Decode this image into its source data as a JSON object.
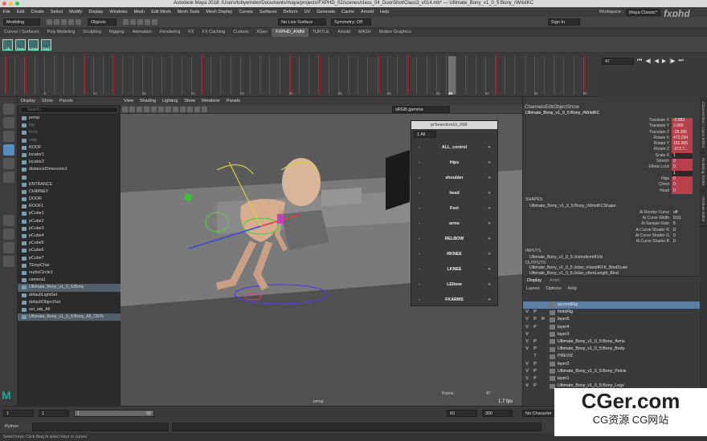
{
  "window": {
    "title": "Autodesk Maya 2018: /Users/tobywinder/Documents/maya/projects/FXPHD_02/scenes/class_04_DoorShot/Class3_v014.mb*  ---  Ultimate_Bony_v1_0_5:Bony_rWristKC"
  },
  "menubar": {
    "items": [
      "File",
      "Edit",
      "Create",
      "Select",
      "Modify",
      "Display",
      "Windows",
      "Mesh",
      "Edit Mesh",
      "Mesh Tools",
      "Mesh Display",
      "Curves",
      "Surfaces",
      "Deform",
      "UV",
      "Generate",
      "Cache",
      "Arnold",
      "Help"
    ],
    "workspace_label": "Workspace :",
    "workspace_value": "Maya Classic*"
  },
  "statusline": {
    "mode": "Modeling",
    "objects": "Objects",
    "live_surface": "No Live Surface",
    "symmetry": "Symmetry: Off",
    "sign_in": "Sign In"
  },
  "shelf": {
    "tabs": [
      "Curves / Surfaces",
      "Poly Modeling",
      "Sculpting",
      "Rigging",
      "Animation",
      "Rendering",
      "FX",
      "FX Caching",
      "Custom",
      "XGen",
      "FXPHD_ANIM",
      "TURTLE",
      "Arnold",
      "MASH",
      "Motion Graphics"
    ],
    "active_tab": "FXPHD_ANIM",
    "buttons": [
      "LIB",
      "Persp",
      "Combo",
      "SNAP"
    ]
  },
  "timeslider": {
    "current_frame": "46",
    "frame_field": "47",
    "labels": [
      "5",
      "10",
      "15",
      "20",
      "25",
      "30",
      "35",
      "40",
      "45",
      "50",
      "55",
      "60"
    ]
  },
  "outliner": {
    "menu": [
      "Display",
      "Show",
      "Panels"
    ],
    "search_placeholder": "Search...",
    "items": [
      {
        "label": "persp",
        "dim": false
      },
      {
        "label": "top",
        "dim": true
      },
      {
        "label": "front",
        "dim": true
      },
      {
        "label": "side",
        "dim": true
      },
      {
        "label": "ROOF",
        "dim": false
      },
      {
        "label": "locator1",
        "dim": false
      },
      {
        "label": "locator2",
        "dim": false
      },
      {
        "label": "distanceDimension1",
        "dim": false
      },
      {
        "label": "",
        "dim": false
      },
      {
        "label": "ENTRANCE",
        "dim": false
      },
      {
        "label": "CHIMNEY",
        "dim": false
      },
      {
        "label": "DOOR",
        "dim": false
      },
      {
        "label": "ROOF1",
        "dim": false
      },
      {
        "label": "pCube1",
        "dim": false
      },
      {
        "label": "pCube2",
        "dim": false
      },
      {
        "label": "pCube3",
        "dim": false
      },
      {
        "label": "pCube4",
        "dim": false
      },
      {
        "label": "pCube5",
        "dim": false
      },
      {
        "label": "pCube6",
        "dim": false
      },
      {
        "label": "pCube7",
        "dim": false
      },
      {
        "label": "TEmpChar",
        "dim": false
      },
      {
        "label": "nurbsCircle1",
        "dim": false
      },
      {
        "label": "camera1",
        "dim": false
      },
      {
        "label": "Ultimate_Bony_v1_0_5:Bony",
        "dim": false,
        "sel": true
      },
      {
        "label": "defaultLightSet",
        "dim": false
      },
      {
        "label": "defaultObjectSet",
        "dim": false
      },
      {
        "label": "set_tab_All",
        "dim": false
      },
      {
        "label": "Ultimate_Bony_v1_0_5:Bony_All_CNTs",
        "dim": false,
        "sel": true
      }
    ]
  },
  "viewport": {
    "menu": [
      "View",
      "Shading",
      "Lighting",
      "Show",
      "Renderer",
      "Panels"
    ],
    "colorspace": "sRGB gamma",
    "camera_label": "persp",
    "frame_label": "Frame:",
    "frame_value": "47",
    "fps": "1.7 fps"
  },
  "selection_ui": {
    "title": "prSelectionUI_098",
    "filter": "1 All",
    "rows": [
      "ALL_control",
      "Hips",
      "shoulder",
      "head",
      "Feet",
      "arms",
      "RELBOW",
      "RKNEE",
      "LKNEE",
      "LElbow",
      "FKARMS"
    ]
  },
  "channel_box": {
    "menu": [
      "Channels",
      "Edit",
      "Object",
      "Show"
    ],
    "object_name": "Ultimate_Bony_v1_0_5:Bony_rWristKC",
    "attributes": [
      {
        "name": "Translate X",
        "value": "-0.883",
        "keyed": true
      },
      {
        "name": "Translate Y",
        "value": "3.989",
        "keyed": true
      },
      {
        "name": "Translate Z",
        "value": "-28.286",
        "keyed": true
      },
      {
        "name": "Rotate X",
        "value": "473.234",
        "keyed": true
      },
      {
        "name": "Rotate Y",
        "value": "182.955",
        "keyed": true
      },
      {
        "name": "Rotate Z",
        "value": "-572.7...",
        "keyed": true
      },
      {
        "name": "Scale X",
        "value": "1",
        "keyed": false
      },
      {
        "name": "Stretch",
        "value": "0",
        "keyed": true
      },
      {
        "name": "Elbow Lock",
        "value": "0",
        "keyed": true
      },
      {
        "name": "",
        "value": "1",
        "keyed": false
      },
      {
        "name": "Hips",
        "value": "0",
        "keyed": true
      },
      {
        "name": "Chest",
        "value": "0",
        "keyed": true
      },
      {
        "name": "Head",
        "value": "0",
        "keyed": true
      }
    ],
    "shapes_header": "SHAPES",
    "shape_name": "Ultimate_Bony_v1_0_5:Bony_rWristKCShape",
    "shape_attrs": [
      {
        "name": "Ai Render Curve",
        "value": "off"
      },
      {
        "name": "Ai Curve Width",
        "value": "0.01"
      },
      {
        "name": "Ai Sample Rate",
        "value": "5"
      },
      {
        "name": "Ai Curve Shader R",
        "value": "0"
      },
      {
        "name": "Ai Curve Shader G",
        "value": "0"
      },
      {
        "name": "Ai Curve Shader B",
        "value": "0"
      }
    ],
    "inputs_header": "INPUTS",
    "inputs": [
      "Ultimate_Bony_v1_0_5:JoIonrArmIKVIz"
    ],
    "outputs_header": "OUTPUTS",
    "outputs": [
      "Ultimate_Bony_v1_0_5:Jolan_rHandIKFK_BlndScale",
      "Ultimate_Bony_v1_0_5:Jolan_rArmLength_Blnd"
    ],
    "side_tabs": [
      "Channel Box / Layer Editor",
      "Modeling Toolkit",
      "Attribute Editor"
    ]
  },
  "layer_editor": {
    "tabs": [
      "Display",
      "Anim"
    ],
    "menu": [
      "Layers",
      "Options",
      "Help"
    ],
    "layers": [
      {
        "v": "",
        "p": "",
        "r": "",
        "name": "secondRig",
        "sel": true
      },
      {
        "v": "V",
        "p": "P",
        "r": "",
        "name": "firstsRig",
        "sel": false
      },
      {
        "v": "V",
        "p": "P",
        "r": "R",
        "name": "layer5",
        "sel": false
      },
      {
        "v": "V",
        "p": "P",
        "r": "",
        "name": "layer4",
        "sel": false
      },
      {
        "v": "V",
        "p": "",
        "r": "",
        "name": "layer3",
        "sel": false
      },
      {
        "v": "V",
        "p": "P",
        "r": "",
        "name": "Ultimate_Bony_v1_0_5:Bony_Arms",
        "sel": false
      },
      {
        "v": "V",
        "p": "P",
        "r": "",
        "name": "Ultimate_Bony_v1_0_5:Bony_Body",
        "sel": false
      },
      {
        "v": "",
        "p": "T",
        "r": "",
        "name": "PREVIZ",
        "sel": false
      },
      {
        "v": "V",
        "p": "P",
        "r": "",
        "name": "layer2",
        "sel": false
      },
      {
        "v": "V",
        "p": "P",
        "r": "",
        "name": "Ultimate_Bony_v1_0_5:Bony_Pelvis",
        "sel": false
      },
      {
        "v": "V",
        "p": "P",
        "r": "",
        "name": "layer1",
        "sel": false
      },
      {
        "v": "V",
        "p": "P",
        "r": "",
        "name": "Ultimate_Bony_v1_0_5:Bony_Legs",
        "sel": false
      }
    ]
  },
  "range": {
    "start": "1",
    "anim_start": "1",
    "range_start": "1",
    "range_end": "60",
    "end": "60",
    "anim_end": "300",
    "character": "No Character"
  },
  "cmdline": {
    "lang": "Python"
  },
  "helpline": {
    "text": "Select keys: Click-drag to select keys or curves"
  },
  "watermark": {
    "brand": "CGer.com",
    "subtitle": "CG资源 CG网站"
  },
  "logo": "fxphd"
}
